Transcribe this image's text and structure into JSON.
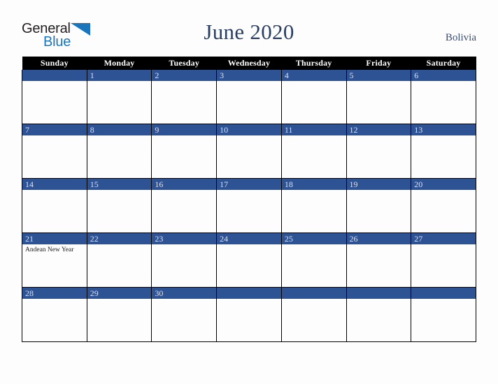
{
  "logo": {
    "word_one": "General",
    "word_two": "Blue",
    "triangle_icon": "triangle-icon",
    "color_dark": "#231f20",
    "color_blue": "#1b75bb"
  },
  "header": {
    "title": "June 2020",
    "country": "Bolivia",
    "title_color": "#2b3f63",
    "country_color": "#3a4f72"
  },
  "calendar": {
    "month": "June",
    "year": "2020",
    "weekday_headers": [
      "Sunday",
      "Monday",
      "Tuesday",
      "Wednesday",
      "Thursday",
      "Friday",
      "Saturday"
    ],
    "header_bg": "#000000",
    "header_fg": "#ffffff",
    "daybar_bg": "#2e5395",
    "daynum_fg": "#dbe0ed",
    "cell_bg": "#fdfdfd",
    "grid_color": "#000000",
    "weeks": [
      [
        {
          "day": "",
          "holiday": ""
        },
        {
          "day": "1",
          "holiday": ""
        },
        {
          "day": "2",
          "holiday": ""
        },
        {
          "day": "3",
          "holiday": ""
        },
        {
          "day": "4",
          "holiday": ""
        },
        {
          "day": "5",
          "holiday": ""
        },
        {
          "day": "6",
          "holiday": ""
        }
      ],
      [
        {
          "day": "7",
          "holiday": ""
        },
        {
          "day": "8",
          "holiday": ""
        },
        {
          "day": "9",
          "holiday": ""
        },
        {
          "day": "10",
          "holiday": ""
        },
        {
          "day": "11",
          "holiday": ""
        },
        {
          "day": "12",
          "holiday": ""
        },
        {
          "day": "13",
          "holiday": ""
        }
      ],
      [
        {
          "day": "14",
          "holiday": ""
        },
        {
          "day": "15",
          "holiday": ""
        },
        {
          "day": "16",
          "holiday": ""
        },
        {
          "day": "17",
          "holiday": ""
        },
        {
          "day": "18",
          "holiday": ""
        },
        {
          "day": "19",
          "holiday": ""
        },
        {
          "day": "20",
          "holiday": ""
        }
      ],
      [
        {
          "day": "21",
          "holiday": "Andean New Year"
        },
        {
          "day": "22",
          "holiday": ""
        },
        {
          "day": "23",
          "holiday": ""
        },
        {
          "day": "24",
          "holiday": ""
        },
        {
          "day": "25",
          "holiday": ""
        },
        {
          "day": "26",
          "holiday": ""
        },
        {
          "day": "27",
          "holiday": ""
        }
      ],
      [
        {
          "day": "28",
          "holiday": ""
        },
        {
          "day": "29",
          "holiday": ""
        },
        {
          "day": "30",
          "holiday": ""
        },
        {
          "day": "",
          "holiday": ""
        },
        {
          "day": "",
          "holiday": ""
        },
        {
          "day": "",
          "holiday": ""
        },
        {
          "day": "",
          "holiday": ""
        }
      ]
    ]
  }
}
